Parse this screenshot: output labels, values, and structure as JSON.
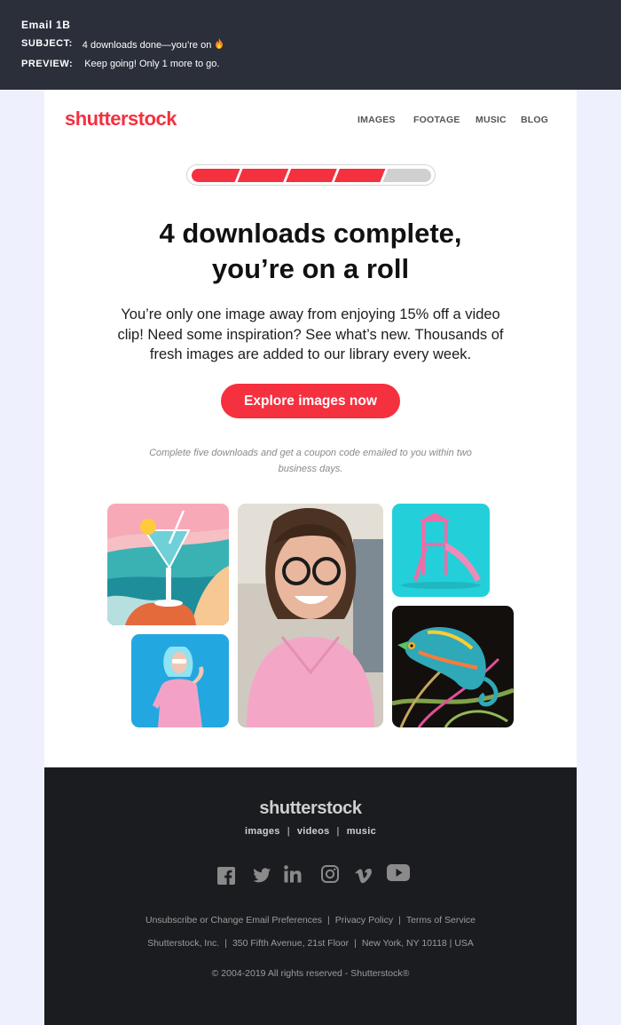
{
  "meta": {
    "title": "Email 1B",
    "subject_label": "SUBJECT:",
    "subject_value": "4 downloads done—you’re on",
    "preview_label": "PREVIEW:",
    "preview_value": "Keep going! Only 1 more to go."
  },
  "header": {
    "logo": "shutterstock",
    "nav": [
      "IMAGES",
      "FOOTAGE",
      "MUSIC",
      "BLOG"
    ]
  },
  "progress": {
    "completed": 4,
    "total": 5,
    "fill_color": "#f5303f",
    "empty_color": "#d0d0d0"
  },
  "main": {
    "headline_line1": "4 downloads complete,",
    "headline_line2": "you’re on a roll",
    "body": "You’re only one image away from enjoying 15% off a video clip! Need some inspiration? See what’s new. Thousands of fresh images are added to our library every week.",
    "cta": "Explore images now",
    "note": "Complete five downloads and get a coupon code emailed to you within two business days."
  },
  "images": [
    {
      "name": "cocktail-illustration-image"
    },
    {
      "name": "smiling-woman-image"
    },
    {
      "name": "pink-slide-image"
    },
    {
      "name": "blue-hair-woman-image"
    },
    {
      "name": "chameleon-image"
    }
  ],
  "footer": {
    "logo": "shutterstock",
    "sub": [
      "images",
      "videos",
      "music"
    ],
    "socials": [
      "facebook-icon",
      "twitter-icon",
      "linkedin-icon",
      "instagram-icon",
      "vimeo-icon",
      "youtube-icon"
    ],
    "links": [
      "Unsubscribe or Change Email Preferences",
      "Privacy Policy",
      "Terms of Service"
    ],
    "address": [
      "Shutterstock, Inc.",
      "350 Fifth Avenue, 21st Floor",
      "New York, NY 10118 | USA"
    ],
    "copyright": "© 2004-2019 All rights reserved - Shutterstock®"
  },
  "colors": {
    "brand_red": "#f5303f",
    "meta_bg": "#2b2f3a",
    "footer_bg": "#1b1c20",
    "page_bg": "#eef1fd"
  }
}
